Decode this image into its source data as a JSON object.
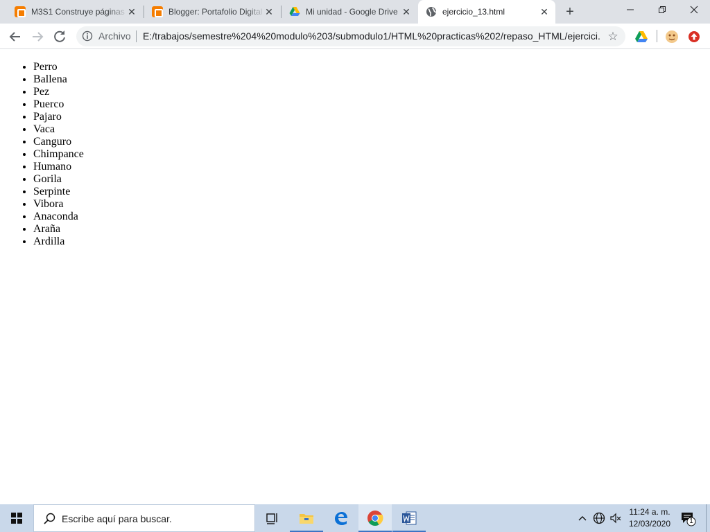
{
  "browser": {
    "tabs": [
      {
        "title": "M3S1 Construye páginas",
        "icon": "blogger-icon"
      },
      {
        "title": "Blogger: Portafolio Digital",
        "icon": "blogger-icon"
      },
      {
        "title": "Mi unidad - Google Drive",
        "icon": "google-drive-icon"
      },
      {
        "title": "ejercicio_13.html",
        "icon": "globe-icon",
        "active": true
      }
    ],
    "address": {
      "chip": "Archivo",
      "url": "E:/trabajos/semestre%204%20modulo%203/submodulo1/HTML%20practicas%202/repaso_HTML/ejercici..."
    }
  },
  "page": {
    "list_items": [
      "Perro",
      "Ballena",
      "Pez",
      "Puerco",
      "Pajaro",
      "Vaca",
      "Canguro",
      "Chimpance",
      "Humano",
      "Gorila",
      "Serpinte",
      "Vibora",
      "Anaconda",
      "Araña",
      "Ardilla"
    ]
  },
  "taskbar": {
    "search_placeholder": "Escribe aquí para buscar.",
    "time": "11:24 a. m.",
    "date": "12/03/2020",
    "notification_count": "1"
  },
  "colors": {
    "tabstrip": "#dee1e6",
    "blogger": "#f57d00",
    "taskbar": "#c9d8ea",
    "accent": "#3c74c4"
  }
}
